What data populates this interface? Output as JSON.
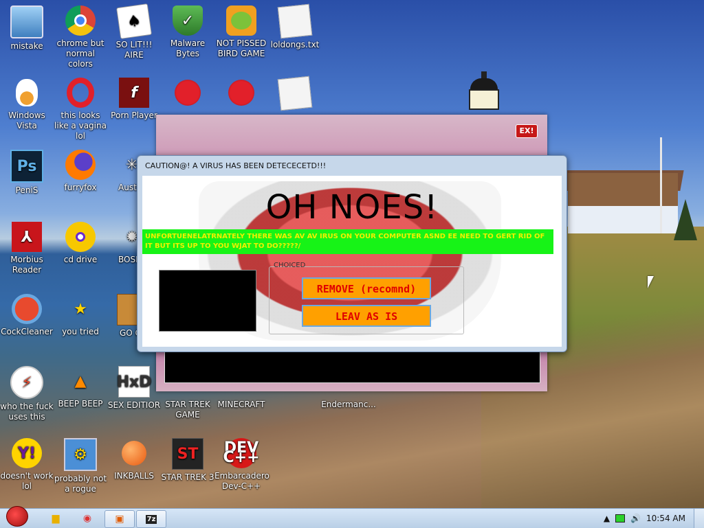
{
  "desktop": {
    "icons": [
      {
        "label": "mistake",
        "icon": "monitor-icon"
      },
      {
        "label": "chrome but normal colors",
        "icon": "chrome-icon"
      },
      {
        "label": "SO LIT!!! AIRE",
        "icon": "cards-icon"
      },
      {
        "label": "Malware Bytes",
        "icon": "shield-icon"
      },
      {
        "label": "NOT PISSED BIRD GAME",
        "icon": "pig-icon"
      },
      {
        "label": "loldongs.txt",
        "icon": "text-file-icon"
      },
      {
        "label": "Windows Vista",
        "icon": "egg-icon"
      },
      {
        "label": "this looks like a vagina lol",
        "icon": "opera-icon"
      },
      {
        "label": "Porn Player",
        "icon": "flash-icon"
      },
      {
        "label": "",
        "icon": "angry-bird-icon"
      },
      {
        "label": "",
        "icon": "angry-bird-icon"
      },
      {
        "label": "",
        "icon": "text-file-icon"
      },
      {
        "label": "PeniS",
        "icon": "photoshop-icon"
      },
      {
        "label": "furryfox",
        "icon": "firefox-icon"
      },
      {
        "label": "Austi",
        "icon": "spider-icon"
      },
      {
        "label": "Morbius Reader",
        "icon": "pdf-icon"
      },
      {
        "label": "cd drive",
        "icon": "cd-icon"
      },
      {
        "label": "BOSI SIMULA",
        "icon": "bomb-icon"
      },
      {
        "label": "CockCleaner",
        "icon": "ccleaner-icon"
      },
      {
        "label": "you tried",
        "icon": "star-icon"
      },
      {
        "label": "GO G GADG",
        "icon": "briefcase-icon"
      },
      {
        "label": "who the fuck uses this",
        "icon": "bolt-icon"
      },
      {
        "label": "BEEP BEEP",
        "icon": "vlc-cone-icon"
      },
      {
        "label": "SEX EDITIOR",
        "icon": "hxd-icon"
      },
      {
        "label": "STAR TREK GAME",
        "icon": ""
      },
      {
        "label": "MINECRAFT",
        "icon": ""
      },
      {
        "label": "Endermanc...",
        "icon": ""
      },
      {
        "label": "doesn't work lol",
        "icon": "yahoo-icon"
      },
      {
        "label": "probably not a rogue",
        "icon": "gears-icon"
      },
      {
        "label": "INKBALLS",
        "icon": "inkball-icon"
      },
      {
        "label": "STAR TREK 3",
        "icon": "star-trek-icon"
      },
      {
        "label": "Embarcadero Dev-C++",
        "icon": "devcpp-icon"
      }
    ]
  },
  "background_window": {
    "close_label": "EX!"
  },
  "dialog": {
    "title": "CAUTION@! A VIRUS HAS BEEN DETECECETD!!!",
    "headline": "OH NOES!",
    "message": "UNFORTUENELATRNATELY THERE WAS AV AV IRUS ON YOUR COMPUTER ASND EE NEED TO GERT RID OF IT BUT ITS UP TO YOU WJAT TO DO?????/",
    "group_label": "CHOICED",
    "remove_label": "REMOVE (recomnd)",
    "leave_label": "LEAV AS IS"
  },
  "taskbar": {
    "clock": "10:54 AM",
    "items": [
      "windows-explorer-icon",
      "chrome-icon",
      "app-window-icon",
      "7zip-icon"
    ]
  },
  "colors": {
    "green_bar": "#17f317",
    "button_bg": "#ffa000",
    "button_text": "#e00000"
  }
}
